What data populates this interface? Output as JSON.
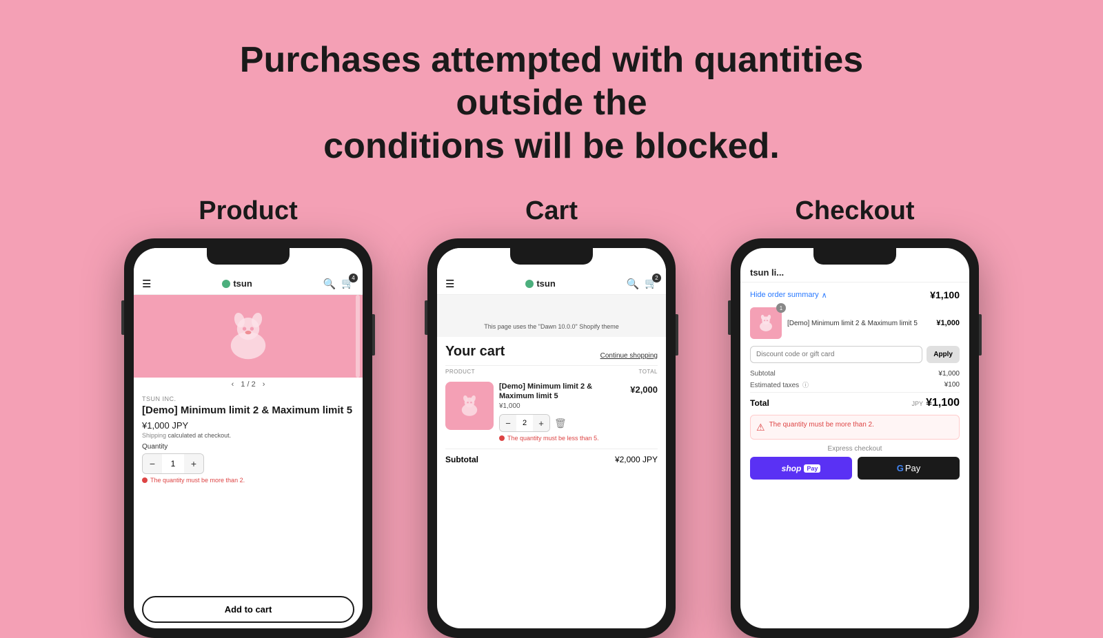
{
  "page": {
    "title_line1": "Purchases attempted with quantities outside the",
    "title_line2": "conditions will be blocked.",
    "background_color": "#f4a0b5"
  },
  "sections": [
    {
      "label": "Product"
    },
    {
      "label": "Cart"
    },
    {
      "label": "Checkout"
    }
  ],
  "product_screen": {
    "brand": "TSUN INC.",
    "product_name": "[Demo] Minimum limit 2 & Maximum limit 5",
    "price": "¥1,000 JPY",
    "shipping_text": "Shipping",
    "shipping_suffix": "calculated at checkout.",
    "quantity_label": "Quantity",
    "quantity_value": "1",
    "image_counter": "1 / 2",
    "error_message": "The quantity must be more than 2.",
    "add_to_cart_label": "Add to cart",
    "nav_logo": "tsun",
    "cart_count": "4"
  },
  "cart_screen": {
    "banner_text": "This page uses the \"Dawn 10.0.0\" Shopify theme",
    "title": "Your cart",
    "continue_shopping": "Continue shopping",
    "col_product": "PRODUCT",
    "col_total": "TOTAL",
    "item_name": "[Demo] Minimum limit 2 & Maximum limit 5",
    "item_price": "¥1,000",
    "item_total": "¥2,000",
    "item_quantity": "2",
    "error_message": "The quantity must be less than 5.",
    "subtotal_label": "Subtotal",
    "subtotal_value": "¥2,000 JPY",
    "nav_logo": "tsun",
    "cart_count": "2"
  },
  "checkout_screen": {
    "store_name": "tsun li...",
    "hide_summary_label": "Hide order summary",
    "order_total": "¥1,100",
    "product_name": "[Demo] Minimum limit 2 & Maximum limit 5",
    "product_price": "¥1,000",
    "badge_count": "1",
    "discount_placeholder": "Discount code or gift card",
    "apply_label": "Apply",
    "subtotal_label": "Subtotal",
    "subtotal_value": "¥1,000",
    "taxes_label": "Estimated taxes",
    "taxes_value": "¥100",
    "total_label": "Total",
    "total_currency": "JPY",
    "total_value": "¥1,100",
    "error_message": "The quantity must be more than 2.",
    "express_checkout_label": "Express checkout",
    "shop_pay_label": "shop",
    "shop_pay_suffix": "Pay",
    "gpay_label": "GPay"
  }
}
